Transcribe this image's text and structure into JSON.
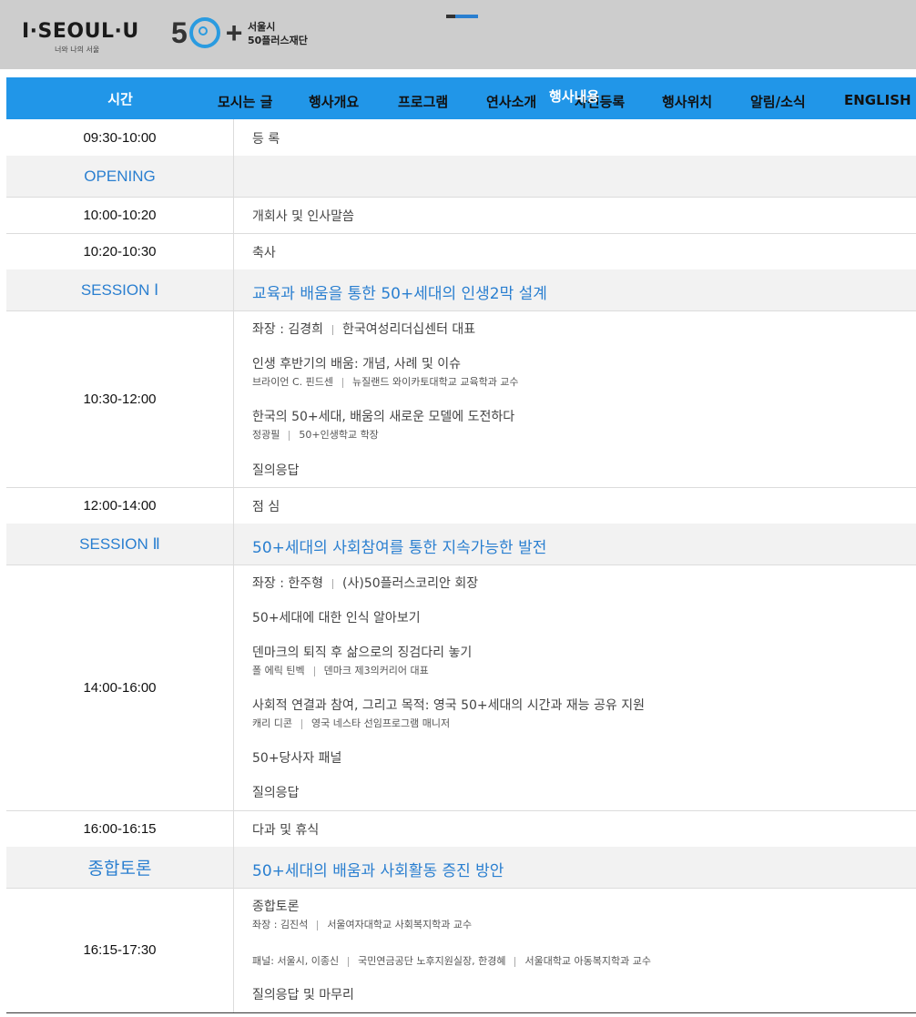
{
  "header": {
    "logo_seoul": "I·SEOUL·U",
    "logo_seoul_sub": "너와 나의 서울",
    "logo_50_num": "50",
    "logo_50_plus": "+",
    "logo_50_line1": "서울시",
    "logo_50_line2": "50플러스재단"
  },
  "nav": {
    "time_header": "시간",
    "items": [
      "모시는 글",
      "행사개요",
      "프로그램",
      "연사소개",
      "사전등록",
      "행사위치",
      "알림/소식",
      "ENGLISH"
    ],
    "overlay_header": "행사내용"
  },
  "schedule": [
    {
      "time": "09:30-10:00",
      "title": "등 록"
    },
    {
      "time": "OPENING",
      "title": ""
    },
    {
      "time": "10:00-10:20",
      "title": "개회사 및 인사말씀"
    },
    {
      "time": "10:20-10:30",
      "title": "축사"
    },
    {
      "time": "SESSION Ⅰ",
      "title": "교육과 배움을 통한 50+세대의 인생2막 설계"
    },
    {
      "time": "10:30-12:00",
      "chair": "좌장 : 김경희",
      "chair_org": "한국여성리더십센터 대표",
      "talk1": "인생 후반기의 배움: 개념, 사례 및 이슈",
      "talk1_speaker": "브라이언 C. 핀드센",
      "talk1_org": "뉴질랜드 와이카토대학교 교육학과 교수",
      "talk2": "한국의 50+세대, 배움의 새로운 모델에 도전하다",
      "talk2_speaker": "정광필",
      "talk2_org": "50+인생학교 학장",
      "qa": "질의응답"
    },
    {
      "time": "12:00-14:00",
      "title": "점 심"
    },
    {
      "time": "SESSION Ⅱ",
      "title": "50+세대의 사회참여를 통한 지속가능한 발전"
    },
    {
      "time": "14:00-16:00",
      "chair": "좌장 : 한주형",
      "chair_org": "(사)50플러스코리안 회장",
      "talk1": "50+세대에 대한 인식 알아보기",
      "talk2": "덴마크의 퇴직 후 삶으로의 징검다리 놓기",
      "talk2_speaker": "폴 에릭 틴벡",
      "talk2_org": "덴마크 제3의커리어 대표",
      "talk3": "사회적 연결과 참여, 그리고 목적: 영국 50+세대의 시간과 재능 공유 지원",
      "talk3_speaker": "캐리 디콘",
      "talk3_org": "영국 네스타 선임프로그램 매니저",
      "panel": "50+당사자 패널",
      "qa": "질의응답"
    },
    {
      "time": "16:00-16:15",
      "title": "다과 및 휴식"
    },
    {
      "time": "종합토론",
      "title": "50+세대의 배움과 사회활동 증진 방안"
    },
    {
      "time": "16:15-17:30",
      "title": "종합토론",
      "chair": "좌장 : 김진석",
      "chair_org": "서울여자대학교 사회복지학과 교수",
      "panel_label": "패널: 서울시, 이종신",
      "panel_org1": "국민연금공단 노후지원실장, 한경혜",
      "panel_org2": "서울대학교 아동복지학과 교수",
      "closing": "질의응답 및 마무리"
    }
  ]
}
